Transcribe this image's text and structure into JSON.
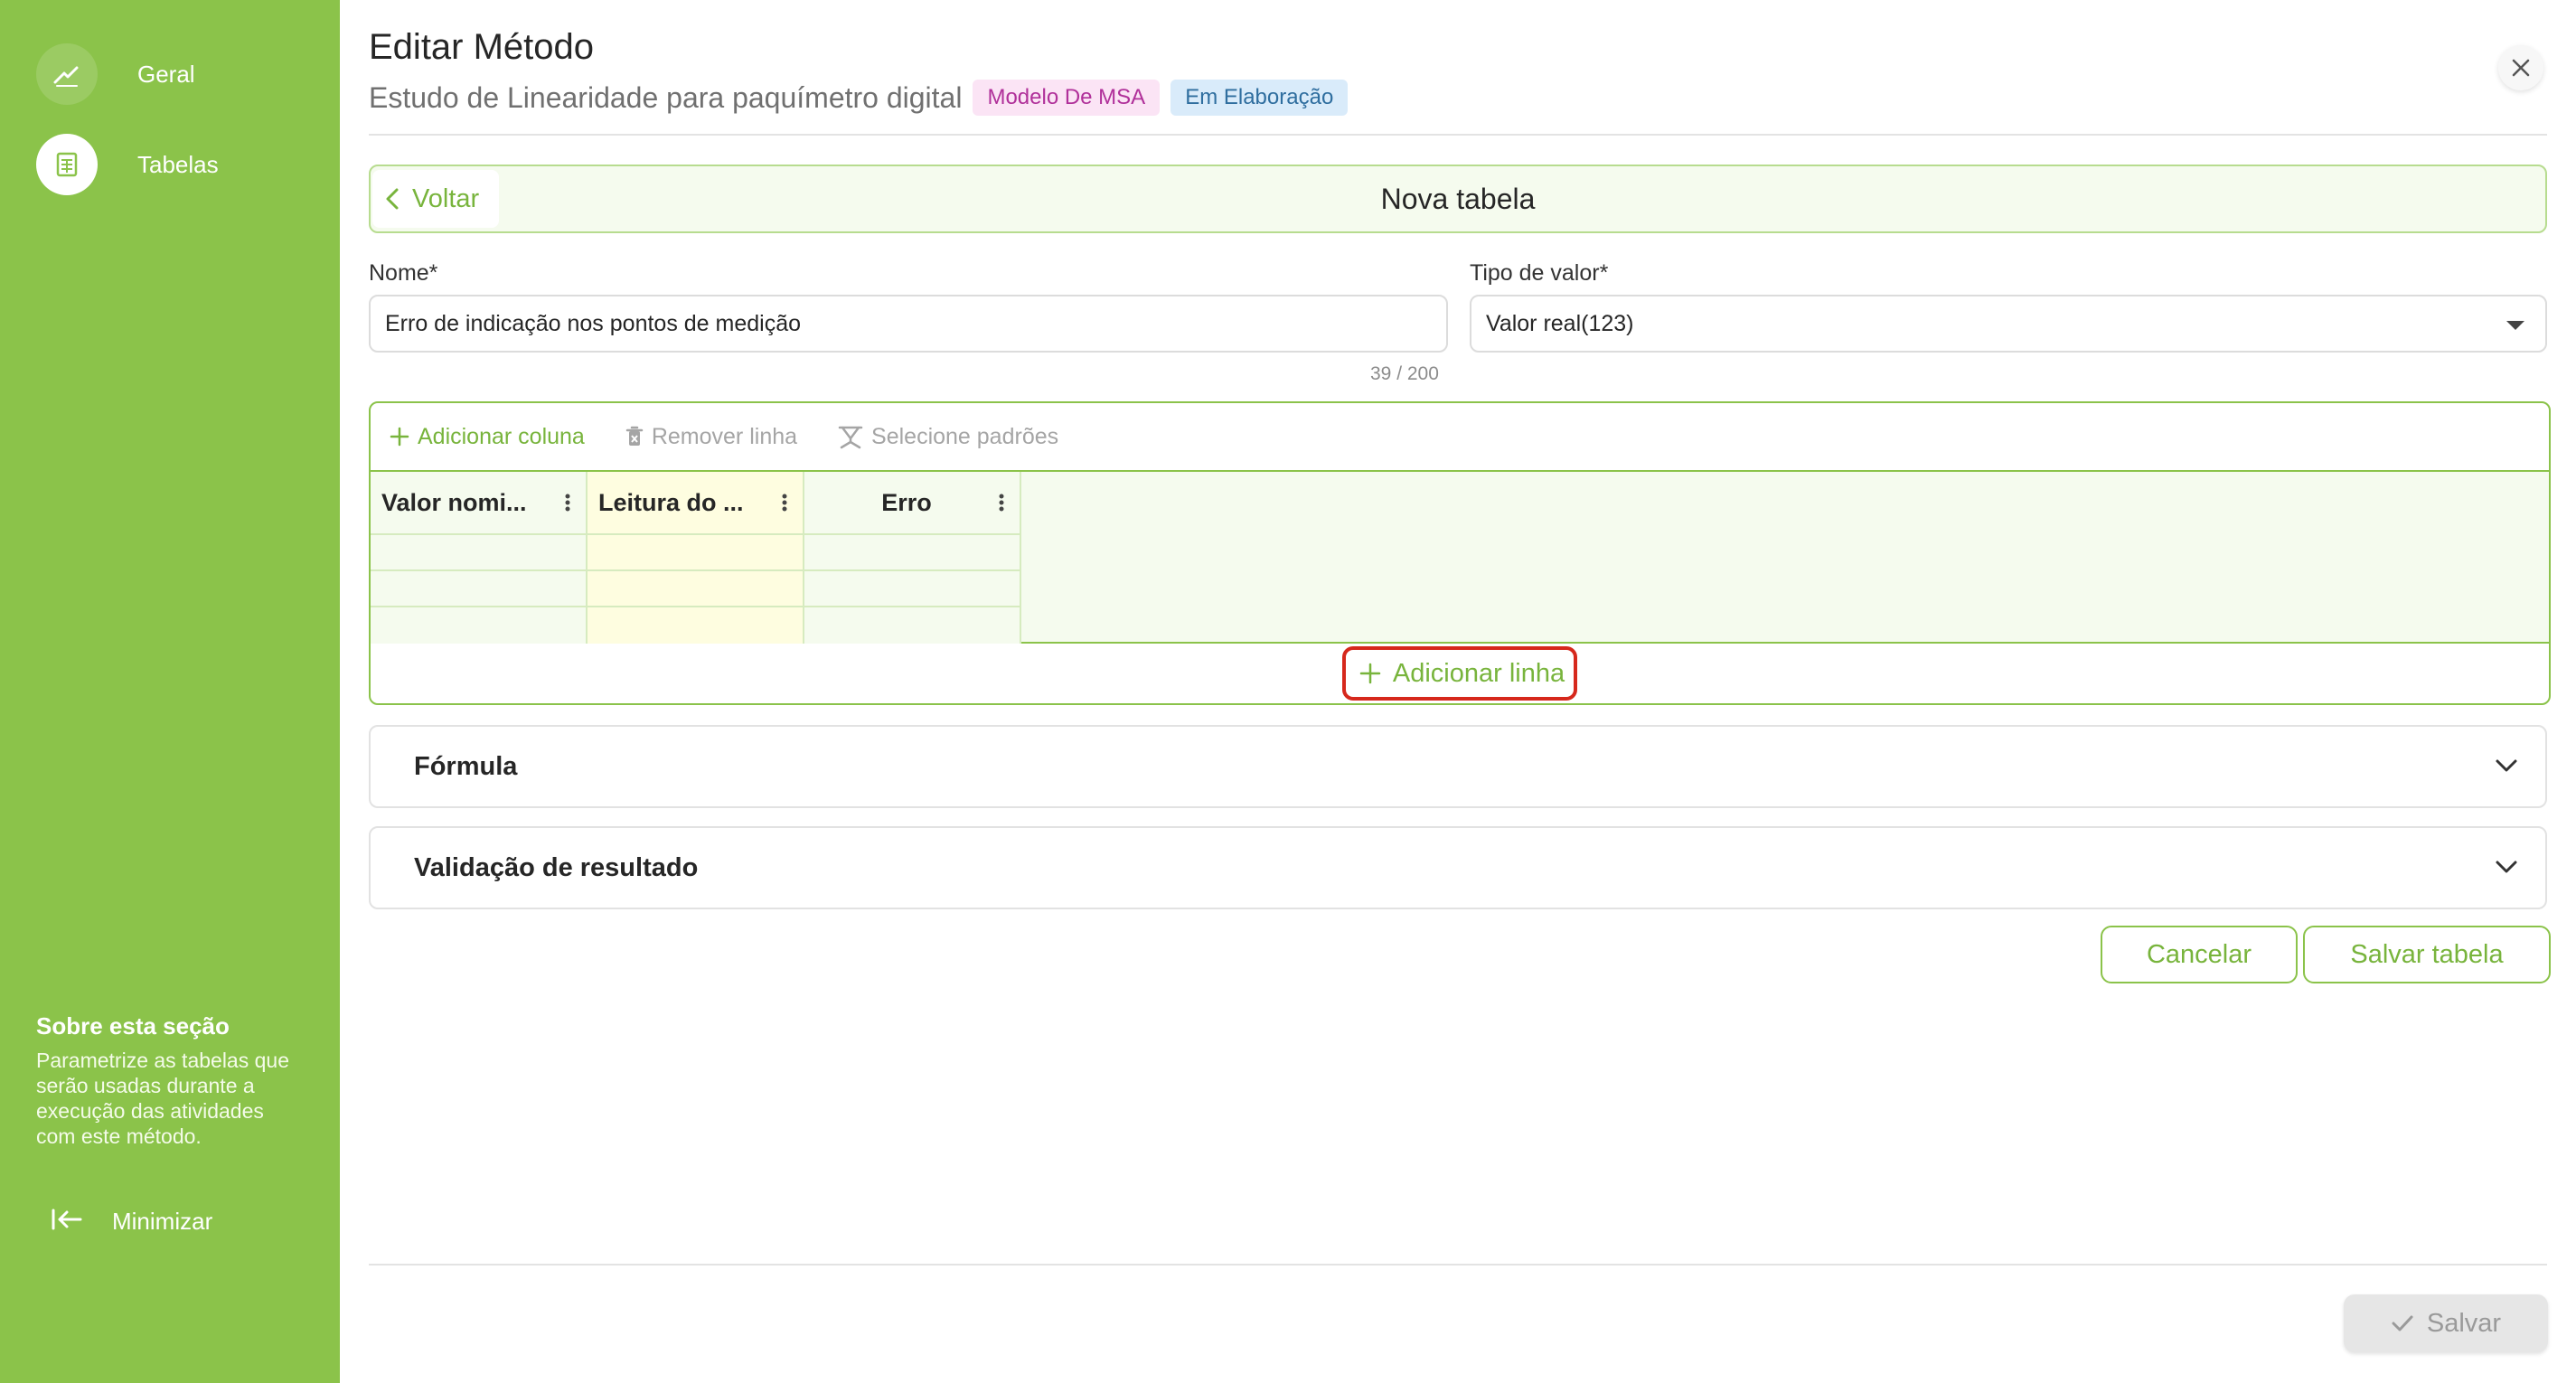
{
  "sidebar": {
    "items": [
      {
        "label": "Geral",
        "icon": "signature-icon",
        "active": false
      },
      {
        "label": "Tabelas",
        "icon": "table-icon",
        "active": true
      }
    ],
    "about_title": "Sobre esta seção",
    "about_text": "Parametrize as tabelas que serão usadas durante a execução das atividades com este método.",
    "minimize_label": "Minimizar"
  },
  "header": {
    "title": "Editar Método",
    "subtitle": "Estudo de Linearidade para paquímetro digital",
    "badges": [
      "Modelo De MSA",
      "Em Elaboração"
    ]
  },
  "card": {
    "back_label": "Voltar",
    "title": "Nova tabela"
  },
  "form": {
    "name_label": "Nome*",
    "name_value": "Erro de indicação nos pontos de medição",
    "name_counter": "39 / 200",
    "type_label": "Tipo de valor*",
    "type_value": "Valor real(123)"
  },
  "table_editor": {
    "toolbar": {
      "add_column": "Adicionar coluna",
      "remove_row": "Remover linha",
      "select_standards": "Selecione padrões"
    },
    "columns": [
      "Valor nomi...",
      "Leitura do ...",
      "Erro"
    ],
    "row_count": 3,
    "add_row_label": "Adicionar linha"
  },
  "sections": {
    "formula": "Fórmula",
    "validation": "Validação de resultado"
  },
  "actions": {
    "cancel": "Cancelar",
    "save_table": "Salvar tabela",
    "save": "Salvar"
  },
  "colors": {
    "sidebar_bg": "#8bc34a",
    "accent": "#78b43c",
    "highlight_border": "#d6281c",
    "yellow_column": "#fefde0"
  }
}
